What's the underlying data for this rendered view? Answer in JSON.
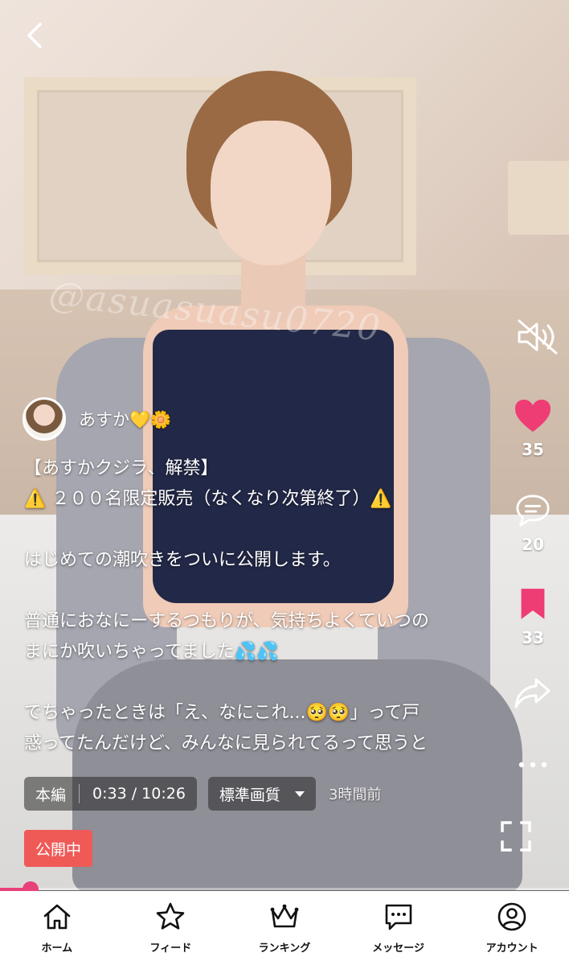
{
  "author": {
    "name": "あすか💛🌼"
  },
  "caption_lines": [
    "【あすかクジラ、解禁】",
    "⚠️ ２００名限定販売（なくなり次第終了）⚠️",
    "",
    "はじめての潮吹きをついに公開します。",
    "",
    "普通におなにーするつもりが、気持ちよくていつの",
    "まにか吹いちゃってました💦💦",
    "",
    "でちゃったときは「え、なにこれ...🥺🥺」って戸",
    "惑ってたんだけど、みんなに見られてるって思うと"
  ],
  "watermark": "@asuasuasu0720",
  "actions": {
    "likes": "35",
    "comments": "20",
    "bookmarks": "33"
  },
  "player": {
    "part_label": "本編",
    "time": "0:33 / 10:26",
    "quality_label": "標準画質",
    "posted_ago": "3時間前",
    "status_badge": "公開中",
    "progress_fraction": 0.053
  },
  "tabbar": [
    {
      "label": "ホーム",
      "icon": "home-icon"
    },
    {
      "label": "フィード",
      "icon": "star-icon"
    },
    {
      "label": "ランキング",
      "icon": "crown-icon"
    },
    {
      "label": "メッセージ",
      "icon": "message-icon"
    },
    {
      "label": "アカウント",
      "icon": "account-icon"
    }
  ],
  "colors": {
    "like": "#ee3c74",
    "bookmark": "#ee3c74",
    "badge": "#ef5a57",
    "progress": "#e8407a"
  }
}
